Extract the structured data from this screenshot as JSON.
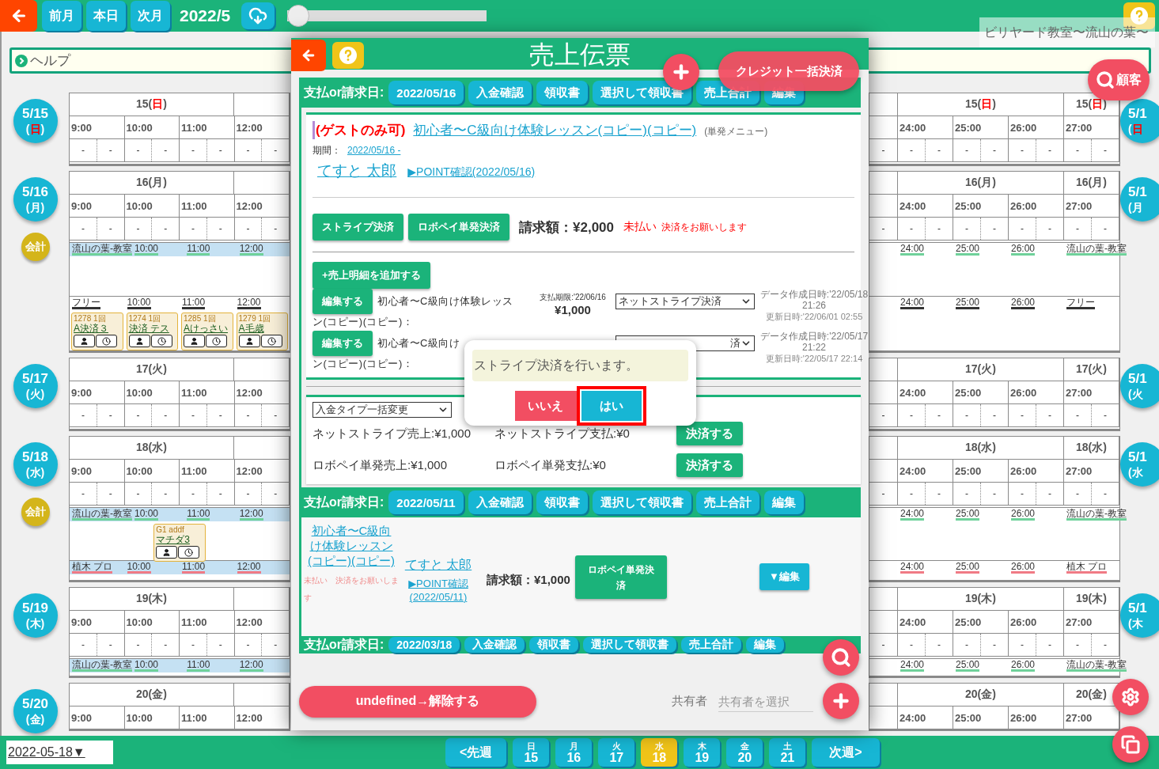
{
  "topbar": {
    "buttons": [
      "前月",
      "本日",
      "次月"
    ],
    "month": "2022/5",
    "slider": {
      "level": 0
    },
    "shop": "ビリヤード教室〜流山の葉〜"
  },
  "help": {
    "label": "ヘルプ"
  },
  "customer_button": "顧客",
  "days": [
    {
      "sunday": true,
      "badge": {
        "date": "5/15",
        "pre": "(",
        "wd": "日",
        "post": ")"
      },
      "header": {
        "pre": "15(",
        "wd": "日",
        "post": ")"
      },
      "right_headers": [
        {
          "pre": "15(",
          "wd": "日",
          "post": ")"
        },
        {
          "pre": "15(",
          "wd": "日",
          "post": ")"
        }
      ],
      "times": [
        "9:00",
        "10:00",
        "11:00",
        "12:00"
      ],
      "right_times": [
        "24:00",
        "25:00",
        "26:00",
        "27:00"
      ],
      "slots": [
        "-",
        "-",
        "-",
        "-",
        "-",
        "-",
        "-",
        "-"
      ],
      "right_slots": [
        "-",
        "-",
        "-",
        "-",
        "-",
        "-",
        "-",
        "-",
        "-"
      ],
      "right_badge": {
        "date": "5/1",
        "pre": "(",
        "wd": "日"
      }
    },
    {
      "sunday": false,
      "badge": {
        "date": "5/16",
        "pre": "(",
        "wd": "月",
        "post": ")"
      },
      "header": {
        "pre": "16(",
        "wd": "月",
        "post": ")"
      },
      "right_headers": [
        {
          "pre": "16(",
          "wd": "月",
          "post": ")"
        },
        {
          "pre": "16(",
          "wd": "月",
          "post": ")"
        }
      ],
      "times": [
        "9:00",
        "10:00",
        "11:00",
        "12:00"
      ],
      "right_times": [
        "24:00",
        "25:00",
        "26:00",
        "27:00"
      ],
      "slots": [
        "-",
        "-",
        "-",
        "-",
        "-",
        "-",
        "-",
        "-"
      ],
      "right_slots": [
        "-",
        "-",
        "-",
        "-",
        "-",
        "-",
        "-",
        "-",
        "-"
      ],
      "accounting": "会計",
      "right_badge": {
        "date": "5/1",
        "pre": "(",
        "wd": "月"
      },
      "lanes": [
        {
          "kind": "classroom",
          "label": "流山の葉-教室",
          "times": [
            "10:00",
            "11:00",
            "12:00"
          ],
          "right": [
            "24:00",
            "25:00",
            "26:00",
            "流山の葉-教室"
          ]
        },
        {
          "kind": "free",
          "label": "フリー",
          "times": [
            "10:00",
            "11:00",
            "12:00"
          ],
          "right": [
            "24:00",
            "25:00",
            "26:00",
            "フリー"
          ],
          "cards": [
            {
              "code": "1278 1回",
              "name": "A決済３"
            },
            {
              "code": "1274 1回",
              "name": "決済 テス"
            },
            {
              "code": "1285 1回",
              "name": "Aけっさい"
            },
            {
              "code": "1279 1回",
              "name": "A毛歳"
            }
          ]
        }
      ]
    },
    {
      "sunday": false,
      "badge": {
        "date": "5/17",
        "pre": "(",
        "wd": "火",
        "post": ")"
      },
      "header": {
        "pre": "17(",
        "wd": "火",
        "post": ")"
      },
      "right_headers": [
        {
          "pre": "17(",
          "wd": "火",
          "post": ")"
        },
        {
          "pre": "17(",
          "wd": "火",
          "post": ")"
        }
      ],
      "times": [
        "9:00",
        "10:00",
        "11:00",
        "12:00"
      ],
      "right_times": [
        "24:00",
        "25:00",
        "26:00",
        "27:00"
      ],
      "slots": [
        "-",
        "-",
        "-",
        "-",
        "-",
        "-",
        "-",
        "-"
      ],
      "right_slots": [
        "-",
        "-",
        "-",
        "-",
        "-",
        "-",
        "-",
        "-",
        "-"
      ],
      "right_badge": {
        "date": "5/1",
        "pre": "(",
        "wd": "火"
      }
    },
    {
      "sunday": false,
      "badge": {
        "date": "5/18",
        "pre": "(",
        "wd": "水",
        "post": ")"
      },
      "header": {
        "pre": "18(",
        "wd": "水",
        "post": ")"
      },
      "right_headers": [
        {
          "pre": "18(",
          "wd": "水",
          "post": ")"
        },
        {
          "pre": "18(",
          "wd": "水",
          "post": ")"
        }
      ],
      "times": [
        "9:00",
        "10:00",
        "11:00",
        "12:00"
      ],
      "right_times": [
        "24:00",
        "25:00",
        "26:00",
        "27:00"
      ],
      "slots": [
        "-",
        "-",
        "-",
        "-",
        "-",
        "-",
        "-",
        "-"
      ],
      "right_slots": [
        "-",
        "-",
        "-",
        "-",
        "-",
        "-",
        "-",
        "-",
        "-"
      ],
      "accounting": "会計",
      "right_badge": {
        "date": "5/1",
        "pre": "(",
        "wd": "水"
      },
      "lanes": [
        {
          "kind": "classroom",
          "label": "流山の葉-教室",
          "times": [
            "10:00",
            "11:00",
            "12:00"
          ],
          "right": [
            "24:00",
            "25:00",
            "26:00",
            "流山の葉-教室"
          ],
          "cards": [
            {
              "code": "G1 addf",
              "name": "マチダ3",
              "shifted": true
            }
          ]
        },
        {
          "kind": "pro",
          "label": "植木 プロ",
          "times": [
            "10:00",
            "11:00",
            "12:00"
          ],
          "right": [
            "24:00",
            "25:00",
            "26:00",
            "植木 プロ"
          ]
        }
      ]
    },
    {
      "sunday": false,
      "badge": {
        "date": "5/19",
        "pre": "(",
        "wd": "木",
        "post": ")"
      },
      "header": {
        "pre": "19(",
        "wd": "木",
        "post": ")"
      },
      "right_headers": [
        {
          "pre": "19(",
          "wd": "木",
          "post": ")"
        },
        {
          "pre": "19(",
          "wd": "木",
          "post": ")"
        }
      ],
      "times": [
        "9:00",
        "10:00",
        "11:00",
        "12:00"
      ],
      "right_times": [
        "24:00",
        "25:00",
        "26:00",
        "27:00"
      ],
      "slots": [
        "-",
        "-",
        "-",
        "-",
        "-",
        "-",
        "-",
        "-"
      ],
      "right_slots": [
        "-",
        "-",
        "-",
        "-",
        "-",
        "-",
        "-",
        "-",
        "-"
      ],
      "right_badge": {
        "date": "5/1",
        "pre": "(",
        "wd": "木"
      },
      "lanes": [
        {
          "kind": "classroom",
          "label": "流山の葉-教室",
          "times": [
            "10:00",
            "11:00",
            "12:00"
          ],
          "right": [
            "24:00",
            "25:00",
            "26:00",
            "流山の葉-教室"
          ]
        }
      ]
    },
    {
      "sunday": false,
      "badge": {
        "date": "5/20",
        "pre": "(",
        "wd": "金",
        "post": ")"
      },
      "header": {
        "pre": "20(",
        "wd": "金",
        "post": ")"
      },
      "right_headers": [
        {
          "pre": "20(",
          "wd": "金",
          "post": ")"
        },
        {
          "pre": "20(",
          "wd": "金",
          "post": ")"
        }
      ],
      "times": [
        "9:00",
        "10:00",
        "11:00",
        "12:00"
      ],
      "right_times": [
        "24:00",
        "25:00",
        "26:00",
        "27:00"
      ]
    }
  ],
  "modal": {
    "title": "売上伝票",
    "credit_button": "クレジット一括決済",
    "sections": [
      {
        "kind": "detail",
        "label": "支払or請求日:",
        "date": "2022/05/16",
        "tabs": [
          "入金確認",
          "領収書",
          "選択して領収書",
          "売上合計",
          "編集"
        ],
        "detail": {
          "badge": "(ゲストのみ可)",
          "menu": "初心者〜C級向け体験レッスン(コピー)(コピー)",
          "menu_type": "(単発メニュー)",
          "period_label": "期間：",
          "period": "2022/05/16 -",
          "customer": "てすと 太郎",
          "point": "▶POINT確認(2022/05/16)",
          "pay_buttons": [
            "ストライプ決済",
            "ロボペイ単発決済"
          ],
          "amount": "請求額：¥2,000",
          "status": "未払い",
          "note": "決済をお願いします",
          "add_button": "+売上明細を追加する",
          "items": [
            {
              "edit": "編集する",
              "lines": [
                "初心者〜C級向け体験レッス",
                "ン(コピー)(コピー)："
              ],
              "due": "支払期限:'22/06/16",
              "price": "¥1,000",
              "method": "ネットストライプ決済",
              "created": "データ作成日時:'22/05/18 21:26",
              "updated": "更新日時:'22/06/01 02:55"
            },
            {
              "edit": "編集する",
              "lines": [
                "初心者〜C級向け",
                "ン(コピー)(コピー)："
              ],
              "method": "済",
              "created": "データ作成日時:'22/05/17 21:22",
              "updated": "更新日時:'22/05/17 22:14"
            }
          ]
        },
        "summary": {
          "select": "入金タイプ一括変更",
          "rows": [
            {
              "sales": "ネットストライプ売上:¥1,000",
              "paid": "ネットストライプ支払:¥0",
              "button": "決済する"
            },
            {
              "sales": "ロボペイ単発売上:¥1,000",
              "paid": "ロボペイ単発支払:¥0",
              "button": "決済する"
            }
          ]
        }
      },
      {
        "kind": "compact",
        "label": "支払or請求日:",
        "date": "2022/05/11",
        "tabs": [
          "入金確認",
          "領収書",
          "選択して領収書",
          "売上合計",
          "編集"
        ],
        "compact": {
          "menu": "初心者〜C級向け体験レッスン(コピー)(コピー)",
          "status": "未払い　決済をお願いします",
          "customer": "てすと 太郎",
          "point": "▶POINT確認(2022/05/11)",
          "amount": "請求額：¥1,000",
          "pay_button": "ロボペイ単発決済",
          "edit_button": "▼編集"
        }
      },
      {
        "kind": "header",
        "label": "支払or請求日:",
        "date": "2022/03/18",
        "tabs": [
          "入金確認",
          "領収書",
          "選択して領収書",
          "売上合計",
          "編集"
        ]
      }
    ],
    "confirm": {
      "message": "ストライプ決済を行います。",
      "no": "いいえ",
      "yes": "はい",
      "highlighted": true
    },
    "footer": {
      "release": "undefined→解除する",
      "share_label": "共有者",
      "share_placeholder": "共有者を選択"
    }
  },
  "bottom": {
    "date": "2022-05-18▼",
    "prev": "<先週",
    "next": "次週>",
    "week": [
      {
        "wd": "日",
        "day": "15",
        "selected": false
      },
      {
        "wd": "月",
        "day": "16",
        "selected": false
      },
      {
        "wd": "火",
        "day": "17",
        "selected": false
      },
      {
        "wd": "水",
        "day": "18",
        "selected": true
      },
      {
        "wd": "木",
        "day": "19",
        "selected": false
      },
      {
        "wd": "金",
        "day": "20",
        "selected": false
      },
      {
        "wd": "土",
        "day": "21",
        "selected": false
      }
    ]
  }
}
